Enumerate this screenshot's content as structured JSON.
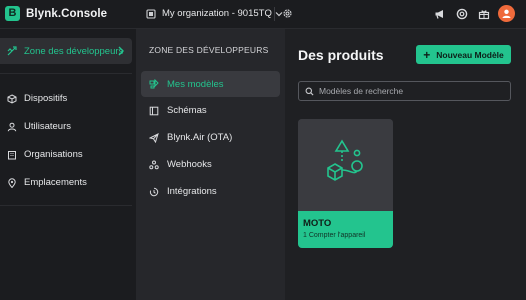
{
  "brand": {
    "logo_letter": "B",
    "name": "Blynk.Console"
  },
  "org": {
    "name": "My organization - 9015TQ"
  },
  "sidebar": {
    "active": {
      "label": "Zone des développeurs",
      "icon": "developer-zone-icon"
    },
    "items": [
      {
        "label": "Dispositifs",
        "icon": "cube-icon"
      },
      {
        "label": "Utilisateurs",
        "icon": "user-icon"
      },
      {
        "label": "Organisations",
        "icon": "building-icon"
      },
      {
        "label": "Emplacements",
        "icon": "location-pin-icon"
      }
    ]
  },
  "subpanel": {
    "title": "ZONE DES DÉVELOPPEURS",
    "items": [
      {
        "label": "Mes modèles",
        "icon": "templates-icon",
        "active": true
      },
      {
        "label": "Schémas",
        "icon": "blueprint-icon"
      },
      {
        "label": "Blynk.Air (OTA)",
        "icon": "paper-plane-icon"
      },
      {
        "label": "Webhooks",
        "icon": "webhook-icon"
      },
      {
        "label": "Intégrations",
        "icon": "integrations-icon"
      }
    ]
  },
  "main": {
    "title": "Des produits",
    "new_button": "Nouveau Modèle",
    "search": {
      "placeholder": "Modèles de recherche",
      "value": ""
    },
    "products": [
      {
        "name": "MOTO",
        "subtitle": "1 Compter l'appareil"
      }
    ]
  },
  "colors": {
    "accent": "#23c48e",
    "avatar": "#ef6a3b",
    "background": "#1b1c1f",
    "panel": "#26272b"
  }
}
